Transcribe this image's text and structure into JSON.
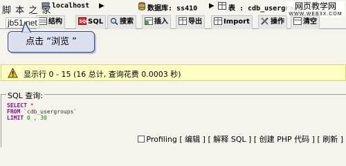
{
  "breadcrumb": {
    "server_label": "localhost",
    "db_label": "数据库: ss410",
    "table_label": "表 : cdb_usergroups"
  },
  "watermarks": {
    "left": "脚 本 之 家",
    "right_main": "网页教学网",
    "right_sub": "WWW.WEB3X.COM",
    "jb51": "jb51.net"
  },
  "tabs": [
    {
      "label": "结构",
      "icon": "structure-icon"
    },
    {
      "label": "SQL",
      "icon": "sql-icon"
    },
    {
      "label": "搜索",
      "icon": "search-icon"
    },
    {
      "label": "插入",
      "icon": "insert-icon"
    },
    {
      "label": "导出",
      "icon": "export-icon"
    },
    {
      "label": "Import",
      "icon": "import-icon"
    },
    {
      "label": "操作",
      "icon": "operations-icon"
    },
    {
      "label": "清空",
      "icon": "empty-icon"
    }
  ],
  "callout": {
    "text": "点击 “浏览 ”"
  },
  "info": {
    "text": "显示行 0 - 15 (16 总计, 查询花费 0.0003 秒)"
  },
  "sql": {
    "legend": "SQL 查询:",
    "select_kw": "SELECT",
    "star": " *",
    "from_kw": "FROM",
    "table": " `cdb_usergroups`",
    "limit_kw": "LIMIT",
    "limit_vals": " 0 , 30"
  },
  "actions": {
    "profiling": "Profiling",
    "edit": "编辑",
    "explain": "解释 SQL",
    "create_php": "创建 PHP 代码",
    "refresh": "刷新"
  },
  "colors": {
    "info_bg": "#ffffc4",
    "page_bg": "#f4f4ec",
    "callout_bg": "#dce1f0",
    "keyword": "#990099"
  }
}
